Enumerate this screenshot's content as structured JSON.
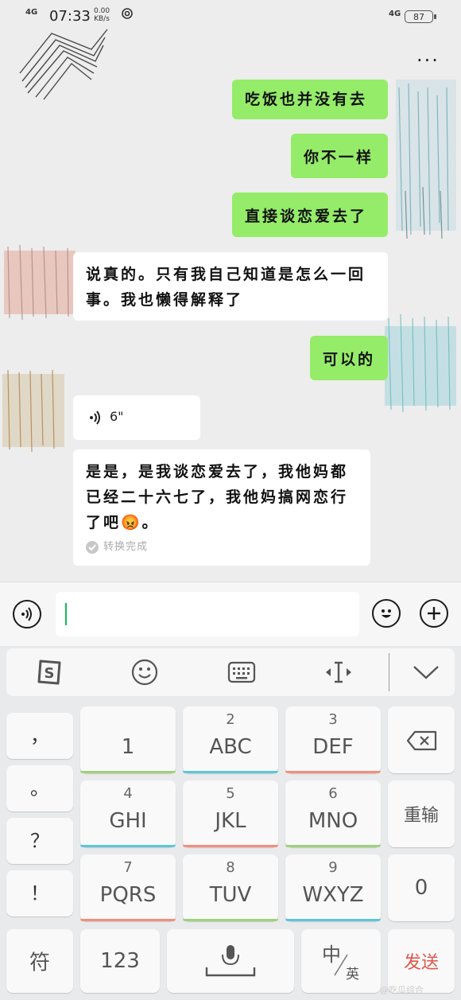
{
  "status_bar": {
    "network_left": "4G",
    "time": "07:33",
    "speed_value": "0.00",
    "speed_unit": "KB/s",
    "network_right": "4G",
    "battery": "87"
  },
  "header": {
    "more_label": "···"
  },
  "messages": [
    {
      "side": "me",
      "text": "吃饭也并没有去"
    },
    {
      "side": "me",
      "text": "你不一样"
    },
    {
      "side": "me",
      "text": "直接谈恋爱去了"
    },
    {
      "side": "other",
      "text": "说真的。只有我自己知道是怎么一回事。我也懒得解释了"
    },
    {
      "side": "me",
      "text": "可以的"
    },
    {
      "side": "other",
      "voice_duration": "6\""
    },
    {
      "side": "other",
      "text": "是是，是我谈恋爱去了，我他妈都已经二十六七了，我他妈搞网恋行了吧😡。",
      "status": "转换完成"
    }
  ],
  "input_bar": {
    "placeholder": ""
  },
  "keyboard": {
    "toolbar": {
      "logo_letter": "S",
      "emoji_icon": "smiley-icon",
      "keyboard_icon": "keyboard-icon",
      "cursor_icon": "cursor-move-icon",
      "collapse_icon": "chevron-down-icon"
    },
    "punctuation": [
      "，",
      "。",
      "？",
      "！"
    ],
    "keys": [
      {
        "num": "",
        "letters": "1",
        "color": "#9ed37a"
      },
      {
        "num": "2",
        "letters": "ABC",
        "color": "#5cc7d9"
      },
      {
        "num": "3",
        "letters": "DEF",
        "color": "#f28f7c"
      },
      {
        "num": "4",
        "letters": "GHI",
        "color": "#5cc7d9"
      },
      {
        "num": "5",
        "letters": "JKL",
        "color": "#f28f7c"
      },
      {
        "num": "6",
        "letters": "MNO",
        "color": "#9ed37a"
      },
      {
        "num": "7",
        "letters": "PQRS",
        "color": "#f28f7c"
      },
      {
        "num": "8",
        "letters": "TUV",
        "color": "#9ed37a"
      },
      {
        "num": "9",
        "letters": "WXYZ",
        "color": "#5cc7d9"
      }
    ],
    "backspace_icon": "backspace-icon",
    "reenter_label": "重输",
    "zero_label": "0",
    "symbol_label": "符",
    "num_label": "123",
    "space_icon": "mic-space-icon",
    "lang_main": "中",
    "lang_sub": "英",
    "send_label": "发送",
    "send_color": "#e0574a"
  },
  "watermark": "@吃瓜综合"
}
